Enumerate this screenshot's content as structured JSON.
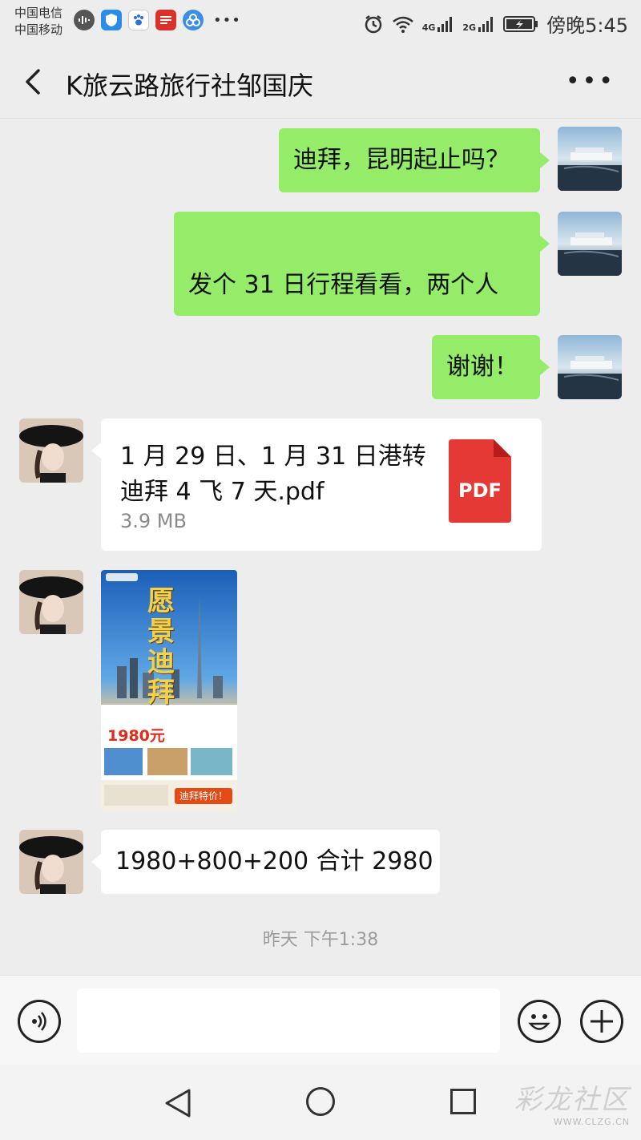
{
  "status_bar": {
    "carrier_1": "中国电信",
    "carrier_2": "中国移动",
    "network_1": "4G",
    "network_2": "2G",
    "time": "傍晚5:45"
  },
  "header": {
    "title": "K旅云路旅行社邹国庆"
  },
  "messages": [
    {
      "side": "right",
      "type": "text",
      "text": "迪拜，昆明起止吗？"
    },
    {
      "side": "right",
      "type": "text",
      "text": "发个 31 日行程看看，两个人"
    },
    {
      "side": "right",
      "type": "text",
      "text": "谢谢！"
    },
    {
      "side": "left",
      "type": "file",
      "file_name": "1 月 29 日、1 月 31 日港转迪拜 4 飞 7 天.pdf",
      "file_size": "3.9 MB",
      "file_icon_label": "PDF"
    },
    {
      "side": "left",
      "type": "image",
      "poster_title": "愿景迪拜",
      "poster_price": "1980元",
      "poster_tag": "迪拜特价！"
    },
    {
      "side": "left",
      "type": "text",
      "text": "1980+800+200 合计 2980"
    }
  ],
  "timestamp": "昨天 下午1:38",
  "input": {
    "placeholder": ""
  },
  "watermark": {
    "main": "彩龙社区",
    "sub": "WWW.CLZG.CN"
  },
  "colors": {
    "sent_bubble": "#95ec69",
    "received_bubble": "#ffffff",
    "background": "#ededed",
    "pdf_red": "#e53935"
  }
}
